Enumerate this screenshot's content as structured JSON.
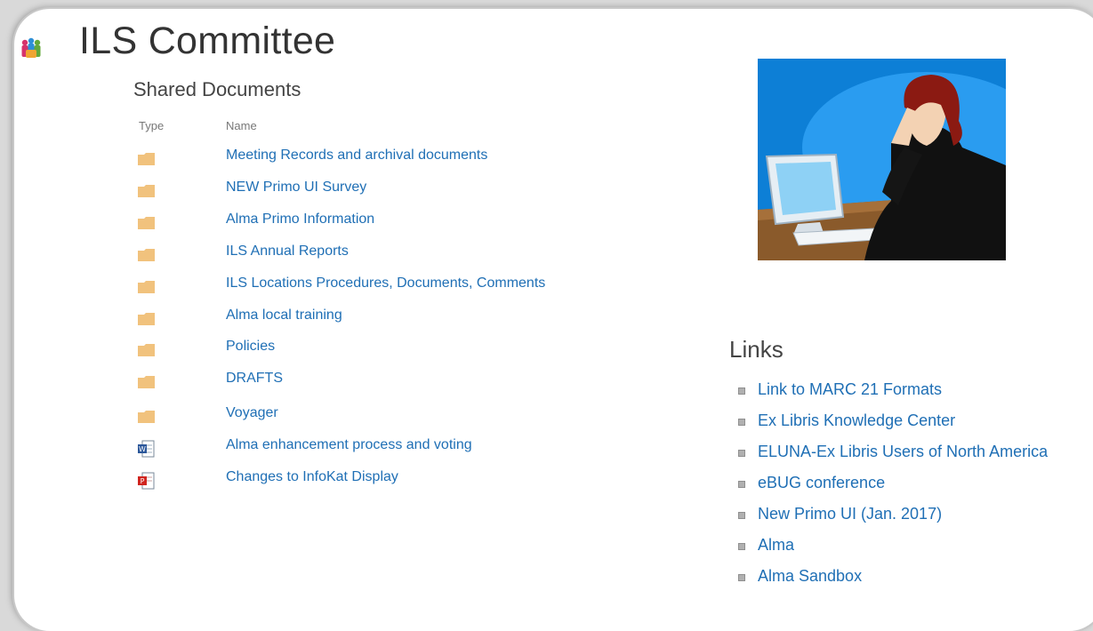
{
  "header": {
    "title": "ILS Committee"
  },
  "documents": {
    "title": "Shared Documents",
    "columns": {
      "type": "Type",
      "name": "Name"
    },
    "items": [
      {
        "type": "folder",
        "name": "Meeting Records and archival documents"
      },
      {
        "type": "folder",
        "name": "NEW Primo UI Survey"
      },
      {
        "type": "folder",
        "name": "Alma Primo Information"
      },
      {
        "type": "folder",
        "name": "ILS Annual Reports"
      },
      {
        "type": "folder",
        "name": "ILS Locations Procedures, Documents, Comments"
      },
      {
        "type": "folder",
        "name": "Alma local training"
      },
      {
        "type": "folder",
        "name": "Policies"
      },
      {
        "type": "folder",
        "name": "DRAFTS"
      },
      {
        "type": "folder",
        "name": "Voyager"
      },
      {
        "type": "word-doc",
        "name": "Alma enhancement process and voting"
      },
      {
        "type": "pdf-doc",
        "name": "Changes to InfoKat Display"
      }
    ]
  },
  "links": {
    "title": "Links",
    "items": [
      "Link to MARC 21 Formats",
      "Ex Libris Knowledge Center",
      "ELUNA-Ex Libris Users of North America",
      "eBUG conference",
      "New Primo UI (Jan. 2017)",
      "Alma",
      "Alma Sandbox"
    ]
  },
  "colors": {
    "link": "#1f6fb5",
    "folder": "#f1c27d",
    "word": "#2b579a",
    "pdf": "#d0251f",
    "illustration_bg": "#0d7fd6"
  }
}
